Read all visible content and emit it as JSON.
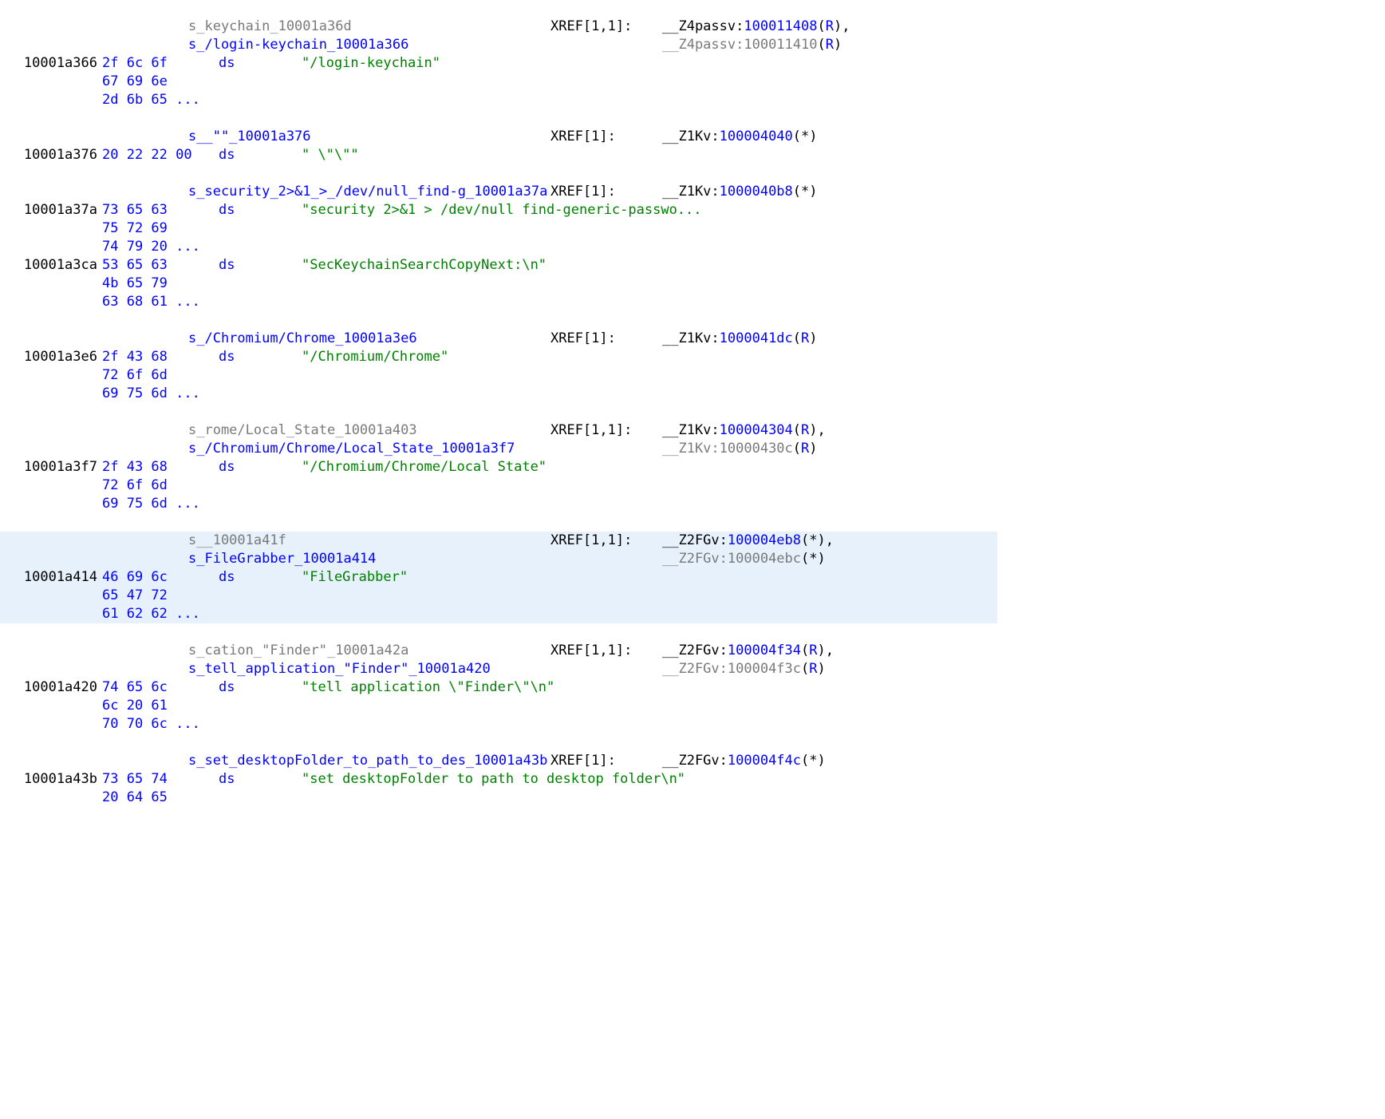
{
  "blocks": [
    {
      "labels": [
        {
          "text": "s_keychain_10001a36d",
          "cls": "gray",
          "xref_label": "XREF[1,1]:",
          "xr": {
            "pre": "__Z4passv:",
            "mid": "100011408",
            "p": "(",
            "suf": "R",
            "q": ")",
            "tail": ",",
            "midcls": "blue",
            "sufcls": "blue"
          }
        },
        {
          "text": "s_/login-keychain_10001a366",
          "cls": "blue",
          "xref_label": "",
          "xr": {
            "pre": "__Z4passv:",
            "mid": "100011410",
            "p": "(",
            "suf": "R",
            "q": ")",
            "tail": "",
            "midcls": "dim",
            "sufcls": "blue",
            "precls": "gray"
          }
        }
      ],
      "rows": [
        {
          "addr": "10001a366",
          "bytes": "2f 6c 6f",
          "ds": "ds",
          "str": "\"/login-keychain\""
        },
        {
          "addr": "",
          "bytes": "67 69 6e"
        },
        {
          "addr": "",
          "bytes": "2d 6b 65 ..."
        }
      ]
    },
    {
      "labels": [
        {
          "text": "s__\"\"_10001a376",
          "cls": "blue",
          "xref_label": "XREF[1]:",
          "xr": {
            "pre": "__Z1Kv:",
            "mid": "100004040",
            "p": "(",
            "suf": "*",
            "q": ")",
            "tail": "",
            "midcls": "blue",
            "sufcls": "black"
          }
        }
      ],
      "rows": [
        {
          "addr": "10001a376",
          "bytes": "20 22 22 00",
          "ds": "ds",
          "str": "\" \\\"\\\"\""
        }
      ]
    },
    {
      "labels": [
        {
          "text": "s_security_2>&1_>_/dev/null_find-g_10001a37a",
          "cls": "blue",
          "xref_label": "XREF[1]:",
          "xr": {
            "pre": "__Z1Kv:",
            "mid": "1000040b8",
            "p": "(",
            "suf": "*",
            "q": ")",
            "tail": "",
            "midcls": "blue",
            "sufcls": "black"
          }
        }
      ],
      "rows": [
        {
          "addr": "10001a37a",
          "bytes": "73 65 63",
          "ds": "ds",
          "str": "\"security 2>&1 > /dev/null find-generic-passwo..."
        },
        {
          "addr": "",
          "bytes": "75 72 69"
        },
        {
          "addr": "",
          "bytes": "74 79 20 ..."
        },
        {
          "addr": "10001a3ca",
          "bytes": "53 65 63",
          "ds": "ds",
          "str": "\"SecKeychainSearchCopyNext:\\n\""
        },
        {
          "addr": "",
          "bytes": "4b 65 79"
        },
        {
          "addr": "",
          "bytes": "63 68 61 ..."
        }
      ],
      "nogap_top": true
    },
    {
      "labels": [
        {
          "text": "s_/Chromium/Chrome_10001a3e6",
          "cls": "blue",
          "xref_label": "XREF[1]:",
          "xr": {
            "pre": "__Z1Kv:",
            "mid": "1000041dc",
            "p": "(",
            "suf": "R",
            "q": ")",
            "tail": "",
            "midcls": "blue",
            "sufcls": "blue"
          }
        }
      ],
      "rows": [
        {
          "addr": "10001a3e6",
          "bytes": "2f 43 68",
          "ds": "ds",
          "str": "\"/Chromium/Chrome\""
        },
        {
          "addr": "",
          "bytes": "72 6f 6d"
        },
        {
          "addr": "",
          "bytes": "69 75 6d ..."
        }
      ]
    },
    {
      "labels": [
        {
          "text": "s_rome/Local_State_10001a403",
          "cls": "gray",
          "xref_label": "XREF[1,1]:",
          "xr": {
            "pre": "__Z1Kv:",
            "mid": "100004304",
            "p": "(",
            "suf": "R",
            "q": ")",
            "tail": ",",
            "midcls": "blue",
            "sufcls": "blue"
          }
        },
        {
          "text": "s_/Chromium/Chrome/Local_State_10001a3f7",
          "cls": "blue",
          "xref_label": "",
          "xr": {
            "pre": "__Z1Kv:",
            "mid": "10000430c",
            "p": "(",
            "suf": "R",
            "q": ")",
            "tail": "",
            "midcls": "dim",
            "sufcls": "blue",
            "precls": "gray"
          }
        }
      ],
      "rows": [
        {
          "addr": "10001a3f7",
          "bytes": "2f 43 68",
          "ds": "ds",
          "str": "\"/Chromium/Chrome/Local State\""
        },
        {
          "addr": "",
          "bytes": "72 6f 6d"
        },
        {
          "addr": "",
          "bytes": "69 75 6d ..."
        }
      ]
    },
    {
      "hl": true,
      "labels": [
        {
          "text": "s__10001a41f",
          "cls": "gray",
          "xref_label": "XREF[1,1]:",
          "xr": {
            "pre": "__Z2FGv:",
            "mid": "100004eb8",
            "p": "(",
            "suf": "*",
            "q": ")",
            "tail": ",",
            "midcls": "blue",
            "sufcls": "black"
          }
        },
        {
          "text": "s_FileGrabber_10001a414",
          "cls": "blue",
          "xref_label": "",
          "xr": {
            "pre": "__Z2FGv:",
            "mid": "100004ebc",
            "p": "(",
            "suf": "*",
            "q": ")",
            "tail": "",
            "midcls": "dim",
            "sufcls": "black",
            "precls": "gray"
          }
        }
      ],
      "rows": [
        {
          "addr": "10001a414",
          "bytes": "46 69 6c",
          "ds": "ds",
          "str": "\"FileGrabber\""
        },
        {
          "addr": "",
          "bytes": "65 47 72"
        },
        {
          "addr": "",
          "bytes": "61 62 62 ..."
        }
      ]
    },
    {
      "labels": [
        {
          "text": "s_cation_\"Finder\"_10001a42a",
          "cls": "gray",
          "xref_label": "XREF[1,1]:",
          "xr": {
            "pre": "__Z2FGv:",
            "mid": "100004f34",
            "p": "(",
            "suf": "R",
            "q": ")",
            "tail": ",",
            "midcls": "blue",
            "sufcls": "blue"
          }
        },
        {
          "text": "s_tell_application_\"Finder\"_10001a420",
          "cls": "blue",
          "xref_label": "",
          "xr": {
            "pre": "__Z2FGv:",
            "mid": "100004f3c",
            "p": "(",
            "suf": "R",
            "q": ")",
            "tail": "",
            "midcls": "dim",
            "sufcls": "blue",
            "precls": "gray"
          }
        }
      ],
      "rows": [
        {
          "addr": "10001a420",
          "bytes": "74 65 6c",
          "ds": "ds",
          "str": "\"tell application \\\"Finder\\\"\\n\""
        },
        {
          "addr": "",
          "bytes": "6c 20 61"
        },
        {
          "addr": "",
          "bytes": "70 70 6c ..."
        }
      ]
    },
    {
      "labels": [
        {
          "text": "s_set_desktopFolder_to_path_to_des_10001a43b",
          "cls": "blue",
          "xref_label": "XREF[1]:",
          "xr": {
            "pre": "__Z2FGv:",
            "mid": "100004f4c",
            "p": "(",
            "suf": "*",
            "q": ")",
            "tail": "",
            "midcls": "blue",
            "sufcls": "black"
          }
        }
      ],
      "rows": [
        {
          "addr": "10001a43b",
          "bytes": "73 65 74",
          "ds": "ds",
          "str": "\"set desktopFolder to path to desktop folder\\n\""
        },
        {
          "addr": "",
          "bytes": "20 64 65"
        }
      ]
    }
  ]
}
